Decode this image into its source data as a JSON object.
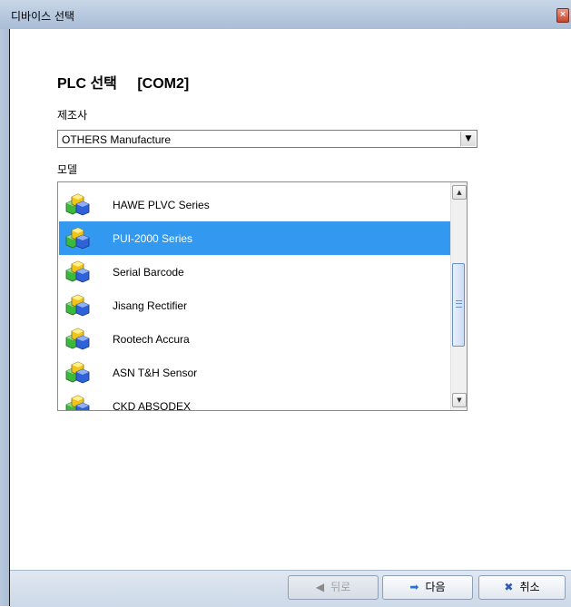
{
  "window": {
    "title": "디바이스 선택",
    "close_glyph": "×"
  },
  "heading": {
    "title": "PLC 선택",
    "port": "[COM2]"
  },
  "manufacturer": {
    "label": "제조사",
    "selected": "OTHERS Manufacture"
  },
  "model": {
    "label": "모델",
    "items": [
      {
        "name": "HAWE PLVC Series",
        "icon": "device-cubes-icon",
        "selected": false
      },
      {
        "name": "PUI-2000 Series",
        "icon": "device-cubes-icon",
        "selected": true
      },
      {
        "name": "Serial Barcode",
        "icon": "device-cubes-icon",
        "selected": false
      },
      {
        "name": "Jisang Rectifier",
        "icon": "device-cubes-icon",
        "selected": false
      },
      {
        "name": "Rootech Accura",
        "icon": "device-cubes-icon",
        "selected": false
      },
      {
        "name": "ASN T&H Sensor",
        "icon": "device-cubes-icon",
        "selected": false
      },
      {
        "name": "CKD ABSODEX",
        "icon": "device-cubes-icon",
        "selected": false
      }
    ]
  },
  "buttons": {
    "back": {
      "label": "뒤로",
      "icon": "arrow-left-icon",
      "enabled": false
    },
    "next": {
      "label": "다음",
      "icon": "arrow-right-icon",
      "enabled": true
    },
    "cancel": {
      "label": "취소",
      "icon": "cancel-x-icon",
      "enabled": true
    }
  },
  "colors": {
    "selection": "#3399f0",
    "titlebar": "#b6c8de",
    "accent_icon": "#2f6fd0"
  }
}
